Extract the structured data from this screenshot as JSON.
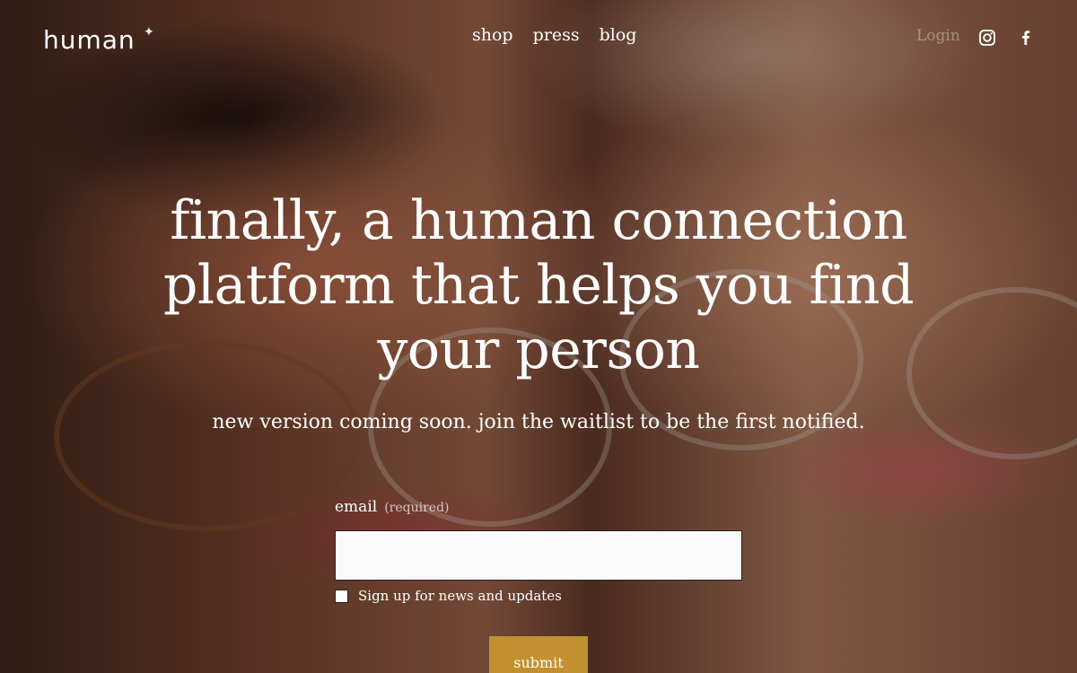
{
  "brand": {
    "logo_text": "human",
    "logo_mark": "✦"
  },
  "nav": {
    "items": [
      {
        "label": "shop"
      },
      {
        "label": "press"
      },
      {
        "label": "blog"
      }
    ],
    "login_label": "Login",
    "social": [
      "instagram-icon",
      "facebook-icon"
    ]
  },
  "hero": {
    "headline": "finally, a human connection platform that helps you find your person",
    "subhead": "new version coming soon. join the waitlist to be the first notified."
  },
  "form": {
    "email_label": "email",
    "email_required": "(required)",
    "email_value": "",
    "checkbox_label": "Sign up for news and updates",
    "checkbox_checked": false,
    "submit_label": "submit"
  },
  "colors": {
    "accent": "#c2902f",
    "input_bg": "#fbfafa"
  }
}
